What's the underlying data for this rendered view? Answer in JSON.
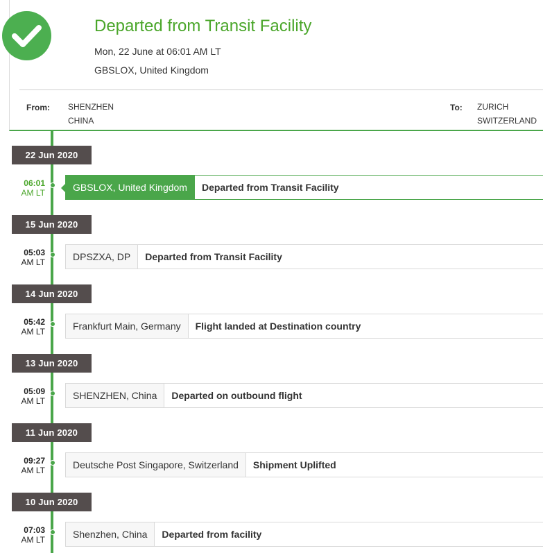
{
  "status": {
    "icon": "check-circle-icon",
    "title": "Departed from Transit Facility",
    "date": "Mon, 22 June at 06:01 AM LT",
    "location": "GBSLOX, United Kingdom"
  },
  "route": {
    "from_label": "From:",
    "from_city": "SHENZHEN",
    "from_country": "CHINA",
    "to_label": "To:",
    "to_city": "ZURICH",
    "to_country": "SWITZERLAND"
  },
  "events": [
    {
      "date": "22 Jun 2020",
      "time": "06:01",
      "ampm": "AM LT",
      "location": "GBSLOX, United Kingdom",
      "description": "Departed from Transit Facility",
      "active": true
    },
    {
      "date": "15 Jun 2020",
      "time": "05:03",
      "ampm": "AM LT",
      "location": "DPSZXA, DP",
      "description": "Departed from Transit Facility",
      "active": false
    },
    {
      "date": "14 Jun 2020",
      "time": "05:42",
      "ampm": "AM LT",
      "location": "Frankfurt Main, Germany",
      "description": "Flight landed at Destination country",
      "active": false
    },
    {
      "date": "13 Jun 2020",
      "time": "05:09",
      "ampm": "AM LT",
      "location": "SHENZHEN, China",
      "description": "Departed on outbound flight",
      "active": false
    },
    {
      "date": "11 Jun 2020",
      "time": "09:27",
      "ampm": "AM LT",
      "location": "Deutsche Post Singapore, Switzerland",
      "description": "Shipment Uplifted",
      "active": false
    },
    {
      "date": "10 Jun 2020",
      "time": "07:03",
      "ampm": "AM LT",
      "location": "Shenzhen, China",
      "description": "Departed from facility",
      "active": false
    }
  ],
  "colors": {
    "accent": "#4aa64a",
    "date_tag": "#544d4d",
    "title": "#4aa62a"
  }
}
